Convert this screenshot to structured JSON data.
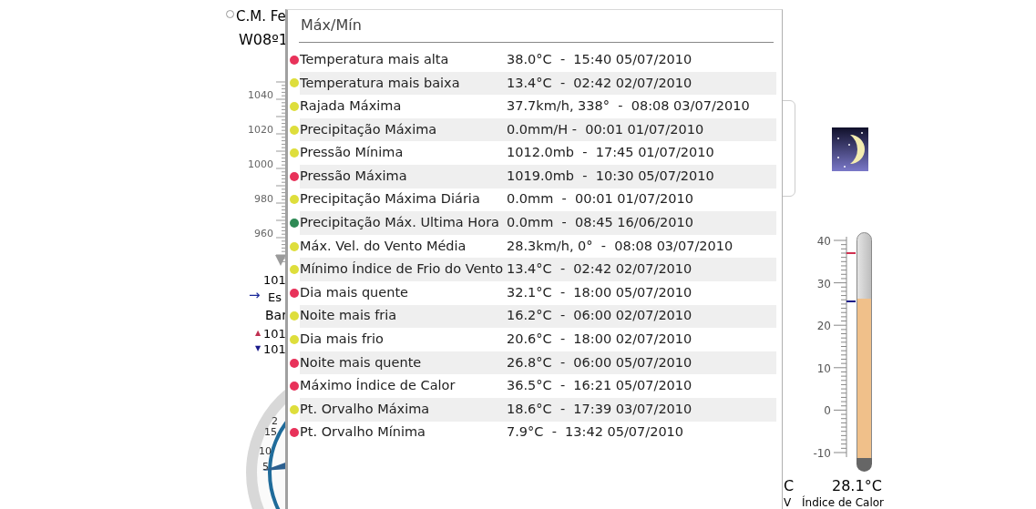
{
  "background": {
    "station": {
      "name": "C.M. Fe",
      "coords": "W08º1"
    },
    "barometer": {
      "ticks": [
        "1040",
        "1020",
        "1000",
        "980",
        "960"
      ],
      "reading": "101",
      "trend_arrow": "→",
      "trend": "Es",
      "label": "Bar",
      "high_mark": "▲",
      "high": "101",
      "low_mark": "▼",
      "low": "101"
    },
    "wind_gauge": {
      "ticks": [
        "2",
        "15",
        "10",
        "5"
      ]
    },
    "thermometer": {
      "ticks": [
        "40",
        "30",
        "20",
        "10",
        "0",
        "-10"
      ],
      "level": 0.762,
      "reading": "28.1°C"
    },
    "fragments": [
      "C",
      "V"
    ],
    "heat_index_label": "Índice de Calor"
  },
  "popup": {
    "title": "Máx/Mín",
    "rows": [
      {
        "color": "#e8325a",
        "label": "Temperatura mais alta",
        "value": "38.0°C  -  15:40 05/07/2010"
      },
      {
        "color": "#dede3c",
        "label": "Temperatura mais baixa",
        "value": "13.4°C  -  02:42 02/07/2010"
      },
      {
        "color": "#dede3c",
        "label": "Rajada Máxima",
        "value": "37.7km/h, 338°  -  08:08 03/07/2010"
      },
      {
        "color": "#dede3c",
        "label": "Precipitação Máxima",
        "value": "0.0mm/H -  00:01 01/07/2010"
      },
      {
        "color": "#dede3c",
        "label": "Pressão Mínima",
        "value": "1012.0mb  -  17:45 01/07/2010"
      },
      {
        "color": "#e8325a",
        "label": "Pressão Máxima",
        "value": "1019.0mb  -  10:30 05/07/2010"
      },
      {
        "color": "#dede3c",
        "label": "Precipitação Máxima Diária",
        "value": "0.0mm  -  00:01 01/07/2010"
      },
      {
        "color": "#2e8a55",
        "label": "Precipitação Máx. Ultima Hora",
        "value": "0.0mm  -  08:45 16/06/2010"
      },
      {
        "color": "#dede3c",
        "label": "Máx. Vel. do Vento Média",
        "value": "28.3km/h, 0°  -  08:08 03/07/2010"
      },
      {
        "color": "#dede3c",
        "label": "Mínimo Índice de Frio do Vento",
        "value": "13.4°C  -  02:42 02/07/2010"
      },
      {
        "color": "#e8325a",
        "label": "Dia mais quente",
        "value": "32.1°C  -  18:00 05/07/2010"
      },
      {
        "color": "#dede3c",
        "label": "Noite mais fria",
        "value": "16.2°C  -  06:00 02/07/2010"
      },
      {
        "color": "#dede3c",
        "label": "Dia mais frio",
        "value": "20.6°C  -  18:00 02/07/2010"
      },
      {
        "color": "#e8325a",
        "label": "Noite mais quente",
        "value": "26.8°C  -  06:00 05/07/2010"
      },
      {
        "color": "#e8325a",
        "label": "Máximo Índice de Calor",
        "value": "36.5°C  -  16:21 05/07/2010"
      },
      {
        "color": "#dede3c",
        "label": "Pt. Orvalho Máxima",
        "value": "18.6°C  -  17:39 03/07/2010"
      },
      {
        "color": "#e8325a",
        "label": "Pt. Orvalho Mínima",
        "value": "7.9°C  -  13:42 05/07/2010"
      }
    ]
  }
}
